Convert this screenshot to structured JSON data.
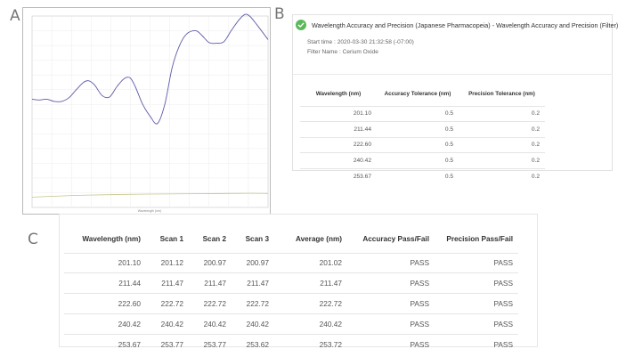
{
  "panel_labels": {
    "a": "A",
    "b": "B",
    "c": "C"
  },
  "chart_data": {
    "type": "line",
    "title": "",
    "xlabel": "Wavelength (nm)",
    "ylabel": "",
    "xlim": [
      196,
      260
    ],
    "ylim": [
      0,
      1.3
    ],
    "grid": true,
    "colors": [
      "#5c5aa8",
      "#c4c48a"
    ],
    "series": [
      {
        "x": [
          196,
          198,
          200,
          202,
          204,
          206,
          208,
          210,
          211.44,
          213,
          215,
          217,
          219,
          221,
          222.6,
          224,
          226,
          228,
          230,
          232,
          234,
          236,
          238,
          240.42,
          242,
          244,
          246,
          248,
          250,
          252,
          253.67,
          255,
          257,
          260
        ],
        "values": [
          0.735,
          0.73,
          0.735,
          0.72,
          0.72,
          0.745,
          0.8,
          0.85,
          0.86,
          0.83,
          0.76,
          0.75,
          0.82,
          0.875,
          0.88,
          0.82,
          0.7,
          0.62,
          0.57,
          0.7,
          0.95,
          1.1,
          1.18,
          1.2,
          1.17,
          1.12,
          1.115,
          1.125,
          1.2,
          1.27,
          1.31,
          1.3,
          1.24,
          1.14
        ]
      },
      {
        "x": [
          196,
          210,
          225,
          240,
          255,
          260
        ],
        "values": [
          0.07,
          0.083,
          0.09,
          0.093,
          0.096,
          0.095
        ]
      }
    ]
  },
  "panel_b": {
    "title": "Wavelength Accuracy and Precision (Japanese Pharmacopeia) - Wavelength Accuracy and Precision (Filter)",
    "start_time": "Start time : 2020-03-30 21:32:58 (-07:00)",
    "filter_name": "Filter Name : Cerium Oxide",
    "headers": [
      "Wavelength (nm)",
      "Accuracy Tolerance (nm)",
      "Precision Tolerance (nm)"
    ],
    "rows": [
      [
        "201.10",
        "0.5",
        "0.2"
      ],
      [
        "211.44",
        "0.5",
        "0.2"
      ],
      [
        "222.60",
        "0.5",
        "0.2"
      ],
      [
        "240.42",
        "0.5",
        "0.2"
      ],
      [
        "253.67",
        "0.5",
        "0.2"
      ]
    ]
  },
  "panel_c": {
    "headers": [
      "Wavelength (nm)",
      "Scan 1",
      "Scan 2",
      "Scan 3",
      "Average (nm)",
      "Accuracy Pass/Fail",
      "Precision Pass/Fail"
    ],
    "rows": [
      [
        "201.10",
        "201.12",
        "200.97",
        "200.97",
        "201.02",
        "PASS",
        "PASS"
      ],
      [
        "211.44",
        "211.47",
        "211.47",
        "211.47",
        "211.47",
        "PASS",
        "PASS"
      ],
      [
        "222.60",
        "222.72",
        "222.72",
        "222.72",
        "222.72",
        "PASS",
        "PASS"
      ],
      [
        "240.42",
        "240.42",
        "240.42",
        "240.42",
        "240.42",
        "PASS",
        "PASS"
      ],
      [
        "253.67",
        "253.77",
        "253.77",
        "253.62",
        "253.72",
        "PASS",
        "PASS"
      ]
    ]
  }
}
